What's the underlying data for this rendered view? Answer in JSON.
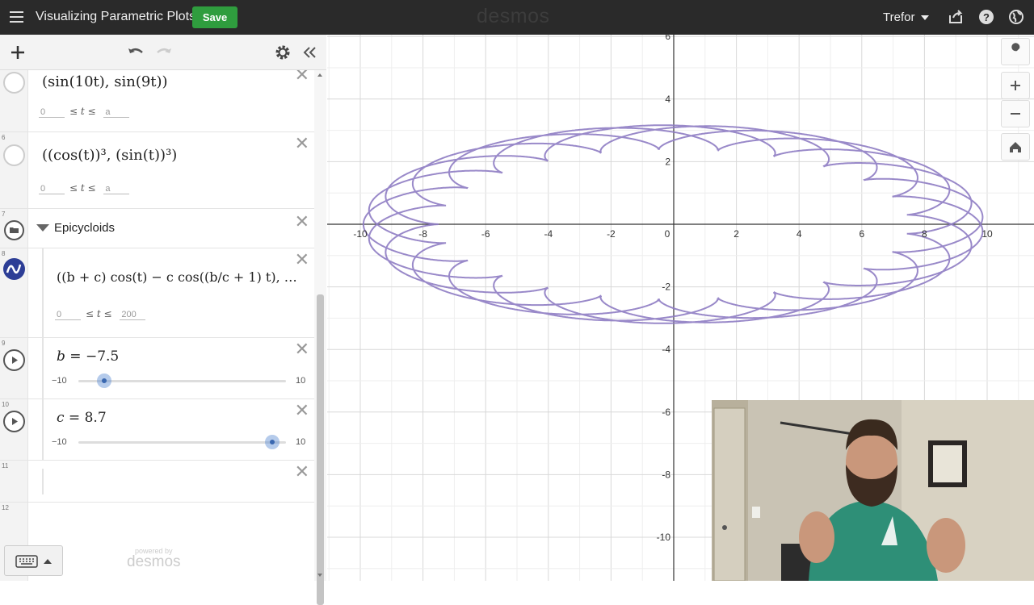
{
  "topbar": {
    "title": "Visualizing Parametric Plots",
    "save_label": "Save",
    "brand": "desmos",
    "user": "Trefor"
  },
  "expressions": [
    {
      "num": "",
      "math": "(sin(10t), sin(9t))",
      "domain": {
        "min": "0",
        "max": "a"
      }
    },
    {
      "num": "6",
      "math": "((cos(t))³, (sin(t))³)",
      "domain": {
        "min": "0",
        "max": "a"
      }
    },
    {
      "num": "7",
      "folder_label": "Epicycloids"
    },
    {
      "num": "8",
      "math": "((b + c) cos(t) − c cos((b/c + 1) t), …",
      "domain": {
        "min": "0",
        "max": "200"
      }
    },
    {
      "num": "9",
      "slider": {
        "var": "b",
        "value": "−7.5",
        "min": "−10",
        "max": "10",
        "value_num": -7.5
      }
    },
    {
      "num": "10",
      "slider": {
        "var": "c",
        "value": "8.7",
        "min": "−10",
        "max": "10",
        "value_num": 8.7
      }
    },
    {
      "num": "11"
    },
    {
      "num": "12"
    }
  ],
  "panel": {
    "powered_by": "powered by",
    "powered_brand": "desmos"
  },
  "graph": {
    "x_ticks": [
      "-10",
      "-8",
      "-6",
      "-4",
      "-2",
      "0",
      "2",
      "4",
      "6",
      "8",
      "10"
    ],
    "y_ticks": [
      "6",
      "4",
      "2",
      "-2",
      "-4",
      "-6",
      "-8",
      "-10"
    ],
    "curve_color": "#8e7cc3",
    "b": -7.5,
    "c": 8.7,
    "t_max": 200
  },
  "graph_tools": [
    "wrench-icon",
    "zoom-in-icon",
    "zoom-out-icon",
    "home-icon"
  ],
  "colors": {
    "save": "#2f9d3e",
    "topbar": "#2a2a2a",
    "curve": "#8e7cc3"
  }
}
